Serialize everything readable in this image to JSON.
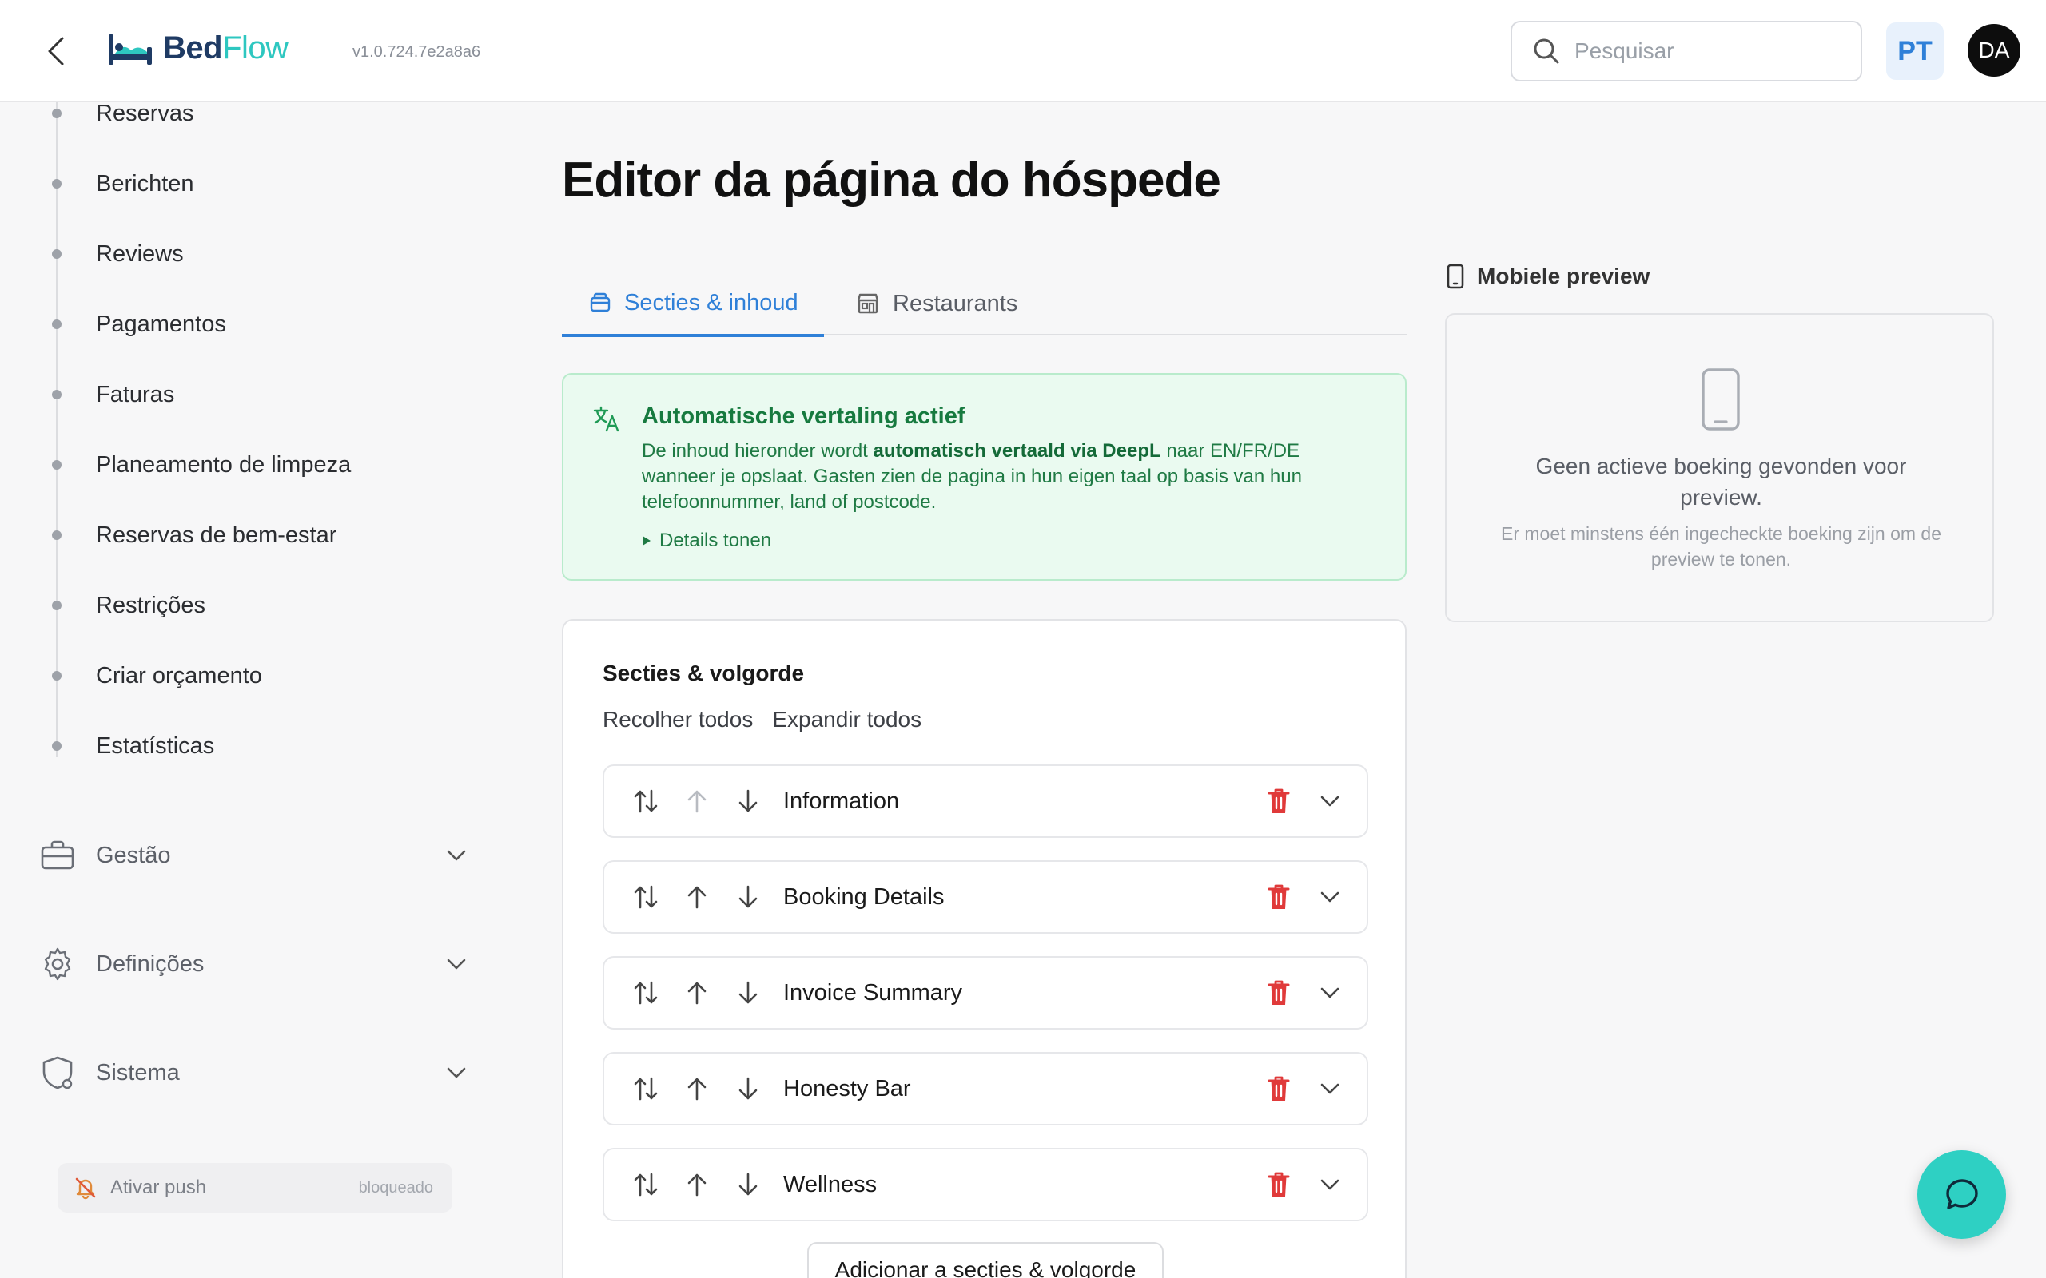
{
  "app": {
    "logo_bed": "Bed",
    "logo_flow": "Flow",
    "version": "v1.0.724.7e2a8a6"
  },
  "header": {
    "search_placeholder": "Pesquisar",
    "language": "PT",
    "avatar": "DA"
  },
  "sidebar": {
    "sub_items": [
      {
        "label": "Reservas"
      },
      {
        "label": "Berichten"
      },
      {
        "label": "Reviews"
      },
      {
        "label": "Pagamentos"
      },
      {
        "label": "Faturas"
      },
      {
        "label": "Planeamento de limpeza"
      },
      {
        "label": "Reservas de bem-estar"
      },
      {
        "label": "Restrições"
      },
      {
        "label": "Criar orçamento"
      },
      {
        "label": "Estatísticas"
      }
    ],
    "groups": [
      {
        "label": "Gestão",
        "icon": "briefcase-icon"
      },
      {
        "label": "Definições",
        "icon": "gear-icon"
      },
      {
        "label": "Sistema",
        "icon": "shield-icon"
      }
    ],
    "push": {
      "label": "Ativar push",
      "state": "bloqueado"
    }
  },
  "main": {
    "title": "Editor da página do hóspede",
    "tabs": [
      {
        "label": "Secties & inhoud",
        "active": true
      },
      {
        "label": "Restaurants",
        "active": false
      }
    ],
    "notice": {
      "title": "Automatische vertaling actief",
      "body_pre": "De inhoud hieronder wordt ",
      "body_bold": "automatisch vertaald via DeepL",
      "body_post": " naar EN/FR/DE wanneer je opslaat. Gasten zien de pagina in hun eigen taal op basis van hun telefoonnummer, land of postcode.",
      "details": "Details tonen"
    },
    "sections_card": {
      "title": "Secties & volgorde",
      "collapse_all": "Recolher todos",
      "expand_all": "Expandir todos",
      "sections": [
        {
          "name": "Information"
        },
        {
          "name": "Booking Details"
        },
        {
          "name": "Invoice Summary"
        },
        {
          "name": "Honesty Bar"
        },
        {
          "name": "Wellness"
        }
      ],
      "add_button": "Adicionar a secties & volgorde"
    }
  },
  "preview": {
    "title": "Mobiele preview",
    "main_text": "Geen actieve boeking gevonden voor preview.",
    "sub_text": "Er moet minstens één ingecheckte boeking zijn om de preview te tonen."
  },
  "colors": {
    "accent": "#2f80d8",
    "brand_teal": "#2ec7c0",
    "delete": "#e03a3a",
    "notice_green": "#177a3f"
  }
}
